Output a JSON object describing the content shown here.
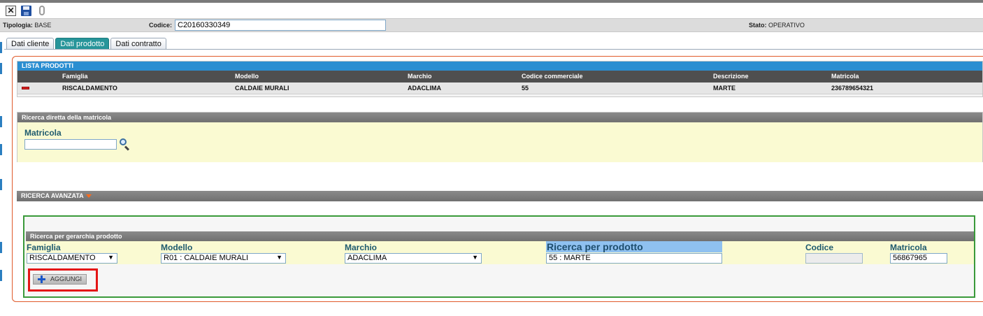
{
  "toolbar": {
    "close_icon": "close-icon",
    "save_icon": "floppy-save-icon",
    "attach_icon": "paperclip-icon"
  },
  "info": {
    "tipologia_label": "Tipologia:",
    "tipologia_value": "BASE",
    "codice_label": "Codice:",
    "codice_value": "C20160330349",
    "stato_label": "Stato:",
    "stato_value": "OPERATIVO"
  },
  "tabs": [
    {
      "label": "Dati cliente",
      "active": false
    },
    {
      "label": "Dati prodotto",
      "active": true
    },
    {
      "label": "Dati contratto",
      "active": false
    }
  ],
  "lista_prodotti": {
    "title": "LISTA PRODOTTI",
    "columns": [
      "Famiglia",
      "Modello",
      "Marchio",
      "Codice commerciale",
      "Descrizione",
      "Matricola"
    ],
    "rows": [
      [
        "RISCALDAMENTO",
        "CALDAIE MURALI",
        "ADACLIMA",
        "55",
        "MARTE",
        "236789654321"
      ]
    ]
  },
  "ricerca_diretta": {
    "title": "Ricerca diretta della matricola",
    "matricola_label": "Matricola",
    "matricola_value": ""
  },
  "ricerca_avanzata": {
    "title": "RICERCA AVANZATA"
  },
  "gerarchia": {
    "title": "Ricerca per gerarchia prodotto",
    "famiglia_label": "Famiglia",
    "famiglia_value": "RISCALDAMENTO",
    "modello_label": "Modello",
    "modello_value": "R01 : CALDAIE MURALI",
    "marchio_label": "Marchio",
    "marchio_value": "ADACLIMA",
    "prodotto_label": "Ricerca per prodotto",
    "prodotto_value": "55 : MARTE",
    "codice_label": "Codice",
    "codice_value": "",
    "matricola_label": "Matricola",
    "matricola_value": "56867965",
    "add_label": "AGGIUNGI"
  },
  "colors": {
    "accent_blue": "#2b8ed1",
    "tab_active": "#27959a",
    "frame_orange": "#e05a2a",
    "frame_green": "#3a9a3a",
    "highlight_red": "#e41515",
    "panel_yellow": "#fafad2"
  }
}
